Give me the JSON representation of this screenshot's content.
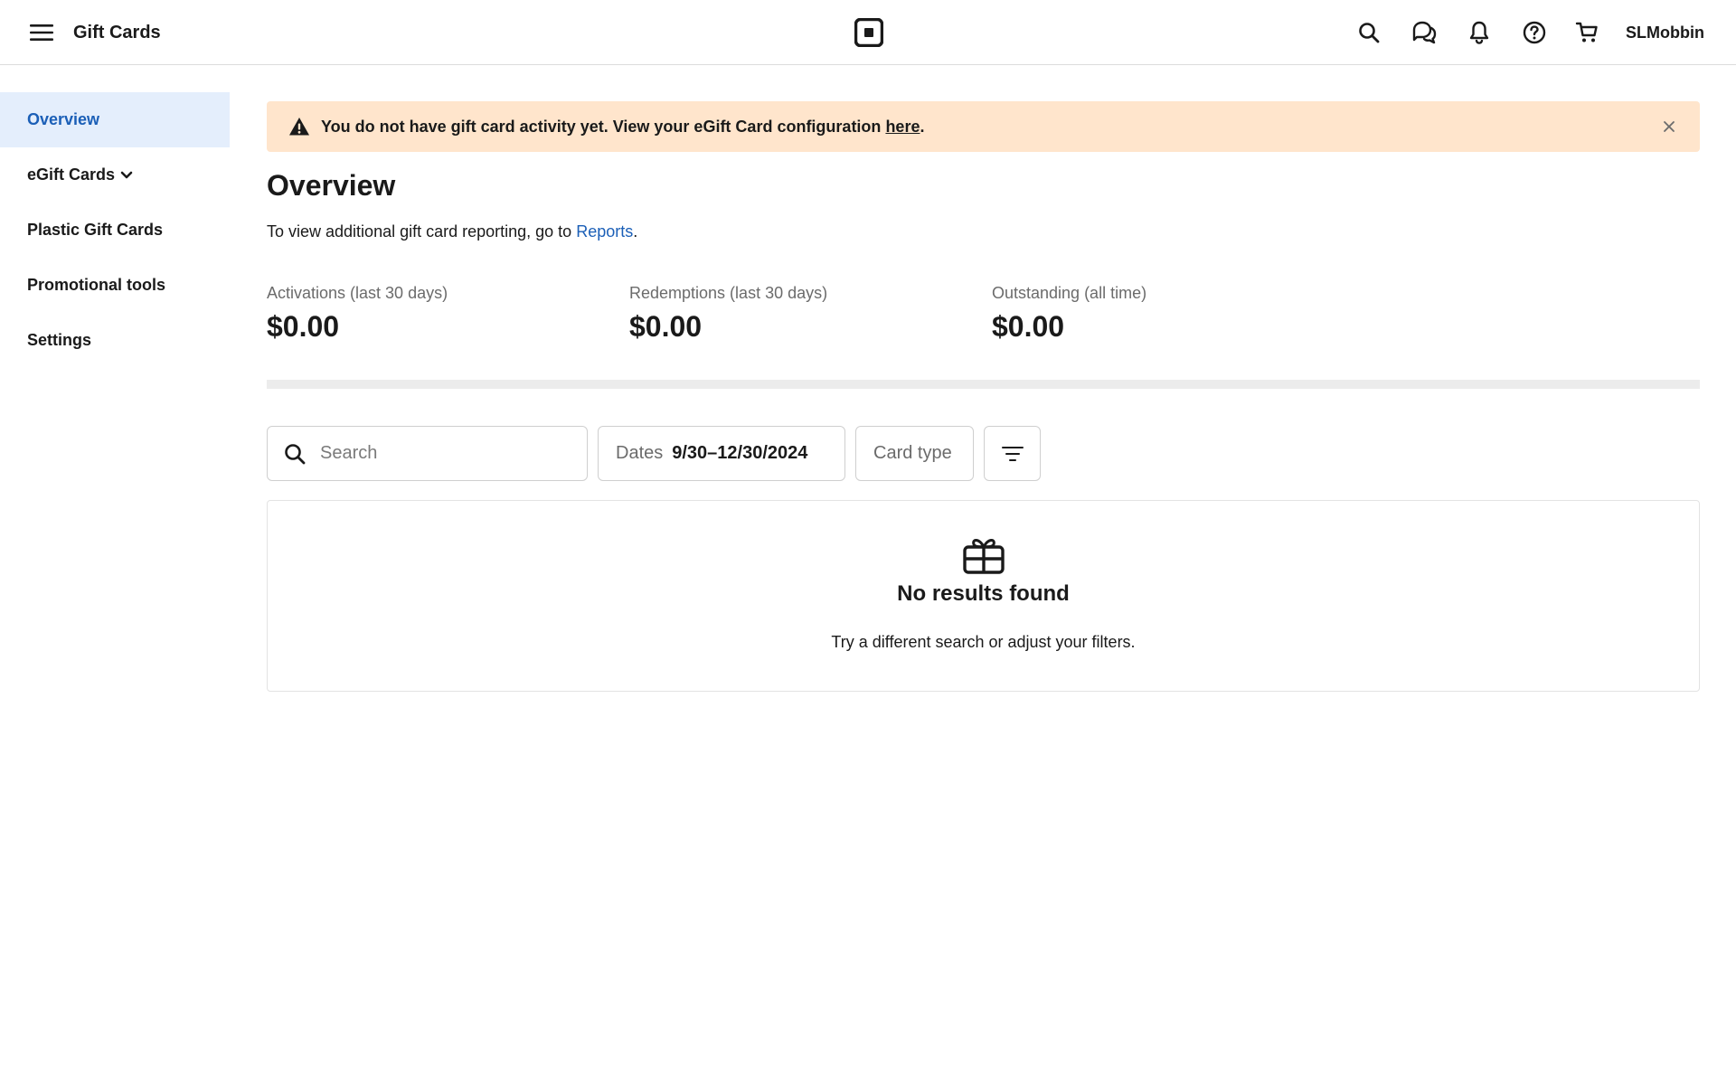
{
  "header": {
    "app_title": "Gift Cards",
    "user_name": "SLMobbin",
    "icons": [
      "menu-icon",
      "square-logo-icon",
      "search-icon",
      "chat-icon",
      "bell-icon",
      "help-icon",
      "cart-icon"
    ]
  },
  "sidebar": {
    "items": [
      {
        "label": "Overview",
        "active": true
      },
      {
        "label": "eGift Cards",
        "has_chevron": true
      },
      {
        "label": "Plastic Gift Cards"
      },
      {
        "label": "Promotional tools"
      },
      {
        "label": "Settings"
      }
    ]
  },
  "alert": {
    "text": "You do not have gift card activity yet. View your eGift Card configuration ",
    "link_text": "here",
    "suffix": ".",
    "color": "#ffe5cc"
  },
  "main": {
    "title": "Overview",
    "subtitle_prefix": "To view additional gift card reporting, go to ",
    "reports_link": "Reports",
    "subtitle_suffix": "."
  },
  "metrics": [
    {
      "label": "Activations (last 30 days)",
      "value": "$0.00"
    },
    {
      "label": "Redemptions (last 30 days)",
      "value": "$0.00"
    },
    {
      "label": "Outstanding (all time)",
      "value": "$0.00"
    }
  ],
  "filters": {
    "search_placeholder": "Search",
    "dates_label": "Dates",
    "dates_value": "9/30–12/30/2024",
    "card_type_label": "Card type"
  },
  "empty_state": {
    "title": "No results found",
    "subtitle": "Try a different search or adjust your filters."
  },
  "colors": {
    "accent": "#1b5fb7",
    "active_nav_bg": "#e4eefc"
  }
}
